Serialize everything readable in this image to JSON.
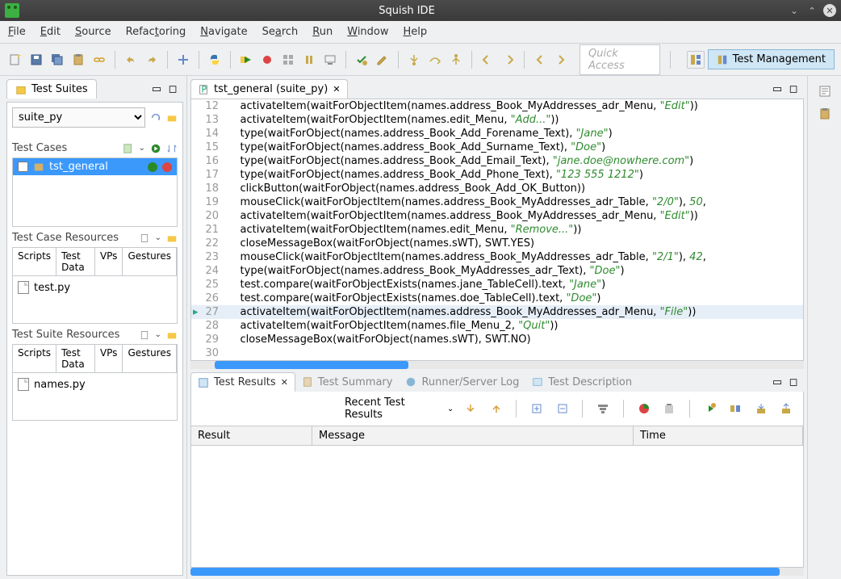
{
  "title": "Squish IDE",
  "menu": [
    "File",
    "Edit",
    "Source",
    "Refactoring",
    "Navigate",
    "Search",
    "Run",
    "Window",
    "Help"
  ],
  "quick_access_placeholder": "Quick Access",
  "perspective": "Test Management",
  "test_suites": {
    "view_label": "Test Suites",
    "selected_suite": "suite_py",
    "test_cases_label": "Test Cases",
    "test_case_items": [
      "tst_general"
    ],
    "test_case_resources_label": "Test Case Resources",
    "tabs": [
      "Scripts",
      "Test Data",
      "VPs",
      "Gestures"
    ],
    "test_case_files": [
      "test.py"
    ],
    "test_suite_resources_label": "Test Suite Resources",
    "test_suite_files": [
      "names.py"
    ]
  },
  "editor": {
    "tab_label": "tst_general (suite_py)",
    "lines": [
      {
        "n": 12,
        "html": "    activateItem(waitForObjectItem(names.address_Book_MyAddresses_adr_Menu, <span class='str'>\"Edit\"</span>))"
      },
      {
        "n": 13,
        "html": "    activateItem(waitForObjectItem(names.edit_Menu, <span class='str'>\"Add...\"</span>))"
      },
      {
        "n": 14,
        "html": "    type(waitForObject(names.address_Book_Add_Forename_Text), <span class='str'>\"Jane\"</span>)"
      },
      {
        "n": 15,
        "html": "    type(waitForObject(names.address_Book_Add_Surname_Text), <span class='str'>\"Doe\"</span>)"
      },
      {
        "n": 16,
        "html": "    type(waitForObject(names.address_Book_Add_Email_Text), <span class='str'>\"jane.doe@nowhere.com\"</span>)"
      },
      {
        "n": 17,
        "html": "    type(waitForObject(names.address_Book_Add_Phone_Text), <span class='str'>\"123 555 1212\"</span>)"
      },
      {
        "n": 18,
        "html": "    clickButton(waitForObject(names.address_Book_Add_OK_Button))"
      },
      {
        "n": 19,
        "html": "    mouseClick(waitForObjectItem(names.address_Book_MyAddresses_adr_Table, <span class='str'>\"2/0\"</span>), <span class='num'>50</span>,"
      },
      {
        "n": 20,
        "html": "    activateItem(waitForObjectItem(names.address_Book_MyAddresses_adr_Menu, <span class='str'>\"Edit\"</span>))"
      },
      {
        "n": 21,
        "html": "    activateItem(waitForObjectItem(names.edit_Menu, <span class='str'>\"Remove...\"</span>))"
      },
      {
        "n": 22,
        "html": "    closeMessageBox(waitForObject(names.sWT), SWT.YES)"
      },
      {
        "n": 23,
        "html": "    mouseClick(waitForObjectItem(names.address_Book_MyAddresses_adr_Table, <span class='str'>\"2/1\"</span>), <span class='num'>42</span>,"
      },
      {
        "n": 24,
        "html": "    type(waitForObject(names.address_Book_MyAddresses_adr_Text), <span class='str'>\"Doe\"</span>)"
      },
      {
        "n": 25,
        "html": "    test.compare(waitForObjectExists(names.jane_TableCell).text, <span class='str'>\"Jane\"</span>)"
      },
      {
        "n": 26,
        "html": "    test.compare(waitForObjectExists(names.doe_TableCell).text, <span class='str'>\"Doe\"</span>)"
      },
      {
        "n": 27,
        "html": "    activateItem(waitForObjectItem(names.address_Book_MyAddresses_adr_Menu, <span class='str'>\"File\"</span>))",
        "active": true
      },
      {
        "n": 28,
        "html": "    activateItem(waitForObjectItem(names.file_Menu_2, <span class='str'>\"Quit\"</span>))"
      },
      {
        "n": 29,
        "html": "    closeMessageBox(waitForObject(names.sWT), SWT.NO)"
      },
      {
        "n": 30,
        "html": ""
      }
    ]
  },
  "results": {
    "tabs": [
      "Test Results",
      "Test Summary",
      "Runner/Server Log",
      "Test Description"
    ],
    "recent_label": "Recent Test Results",
    "columns": [
      "Result",
      "Message",
      "Time"
    ]
  }
}
